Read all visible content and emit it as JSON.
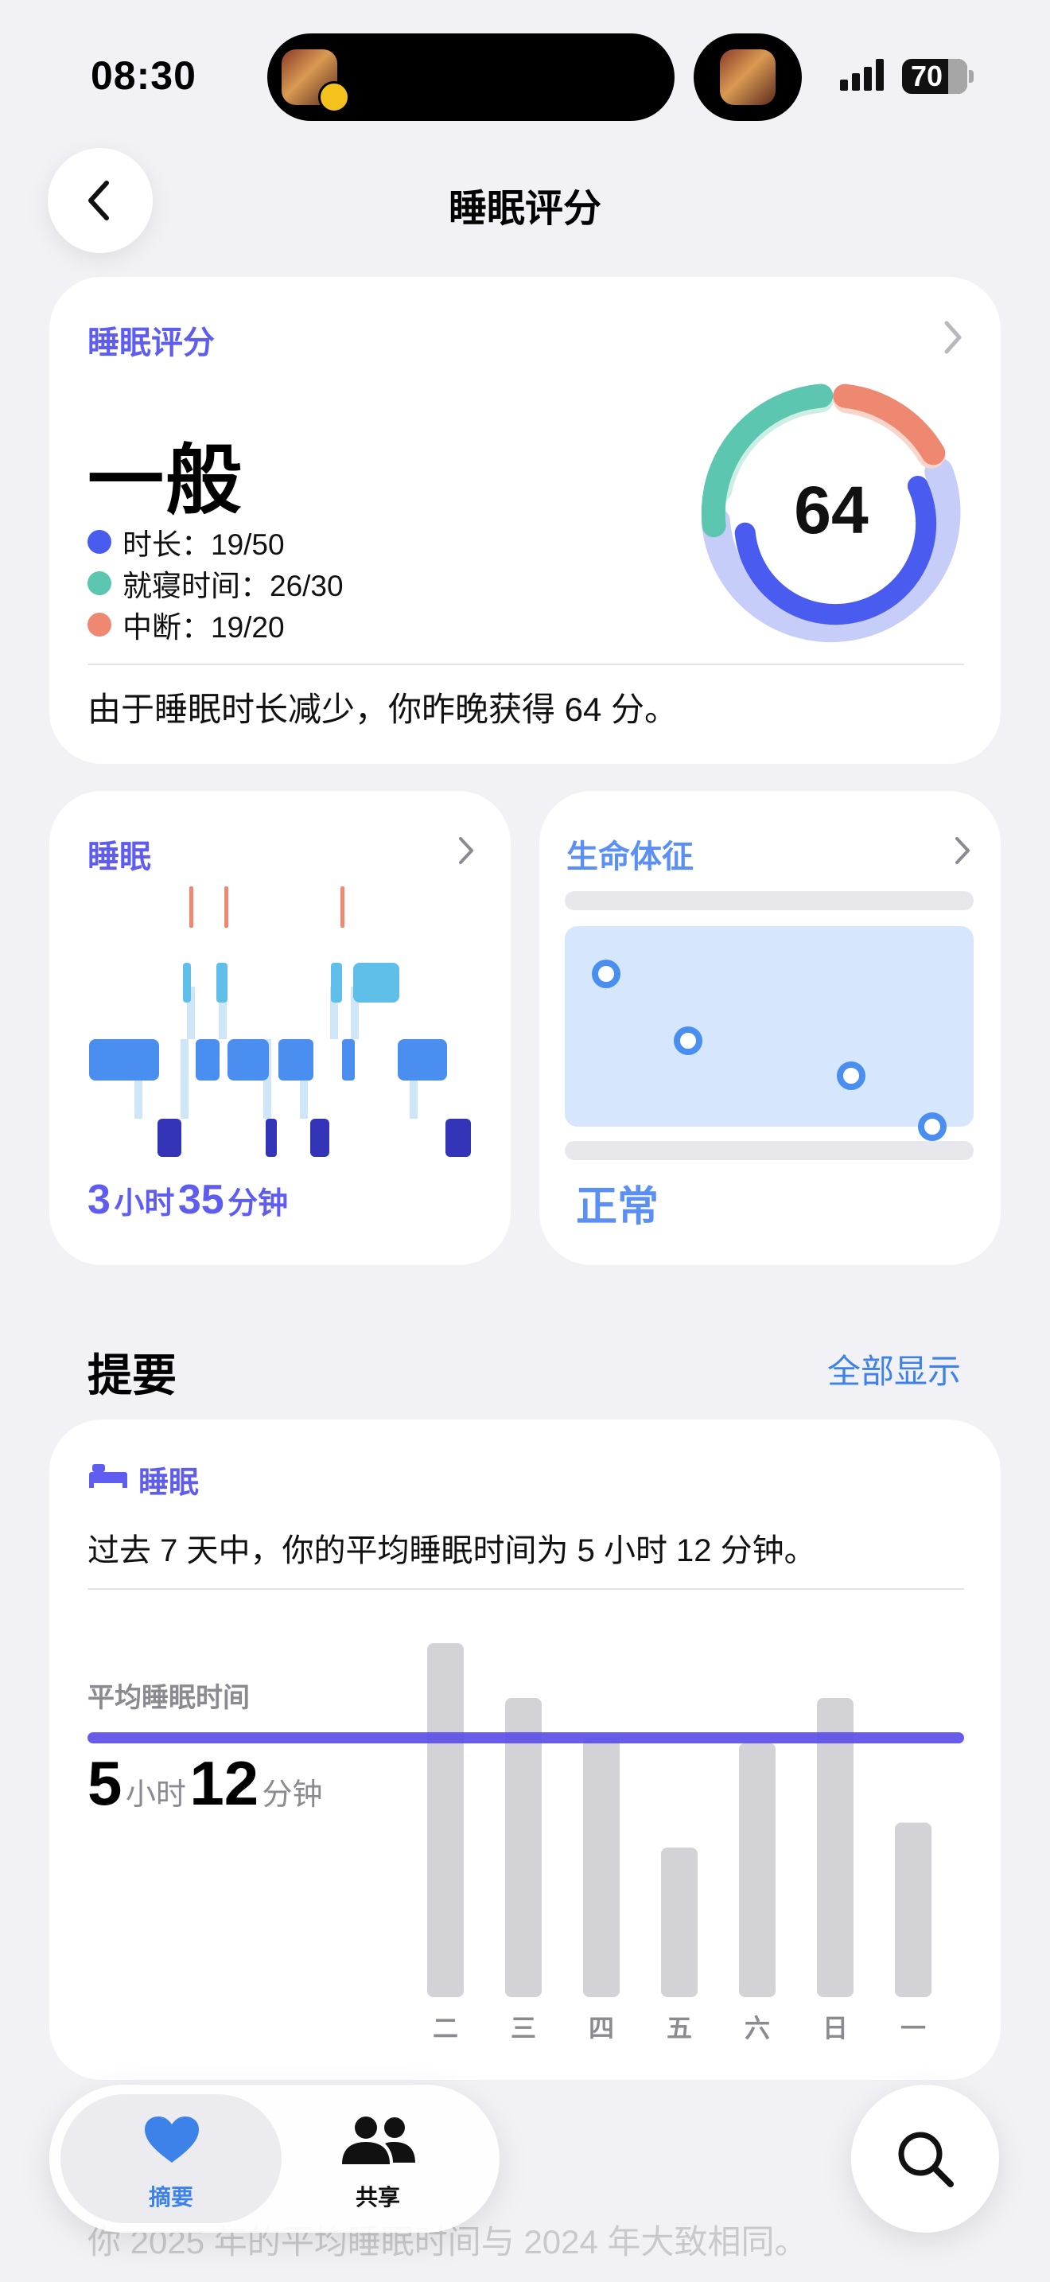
{
  "status_bar": {
    "time": "08:30",
    "battery": "70"
  },
  "header": {
    "title": "睡眠评分"
  },
  "score_card": {
    "label": "睡眠评分",
    "rating": "一般",
    "score": "64",
    "metrics": [
      {
        "text": "时长：19/50",
        "color": "#4a5cf0"
      },
      {
        "text": "就寝时间：26/30",
        "color": "#5cc6b0"
      },
      {
        "text": "中断：19/20",
        "color": "#ee8870"
      }
    ],
    "summary": "由于睡眠时长减少，你昨晚获得 64 分。"
  },
  "sleep_card": {
    "label": "睡眠",
    "hours": "3",
    "hours_unit": "小时",
    "minutes": "35",
    "minutes_unit": "分钟"
  },
  "vitals_card": {
    "label": "生命体征",
    "status": "正常"
  },
  "highlights": {
    "title": "提要",
    "show_all": "全部显示",
    "card_label": "睡眠",
    "text": "过去 7 天中，你的平均睡眠时间为 5 小时 12 分钟。",
    "avg_label": "平均睡眠时间",
    "avg_hours": "5",
    "avg_hours_unit": "小时",
    "avg_minutes": "12",
    "avg_minutes_unit": "分钟"
  },
  "chart_data": {
    "type": "bar",
    "categories": [
      "二",
      "三",
      "四",
      "五",
      "六",
      "日",
      "一"
    ],
    "values": [
      7.1,
      6.0,
      5.2,
      3.0,
      5.1,
      6.0,
      3.5
    ],
    "average": 5.2,
    "ylim": [
      0,
      7.5
    ],
    "title": "",
    "xlabel": "",
    "ylabel": "",
    "bar_color": "#d3d2d7",
    "average_line_color": "#5a4fe8"
  },
  "faded_text": "你 2025 年的平均睡眠时间与 2024 年大致相同。",
  "tabbar": {
    "summary_label": "摘要",
    "sharing_label": "共享"
  },
  "colors": {
    "accent": "#5f5cf0",
    "link": "#3d82e8",
    "vitals": "#5b8ff3"
  }
}
